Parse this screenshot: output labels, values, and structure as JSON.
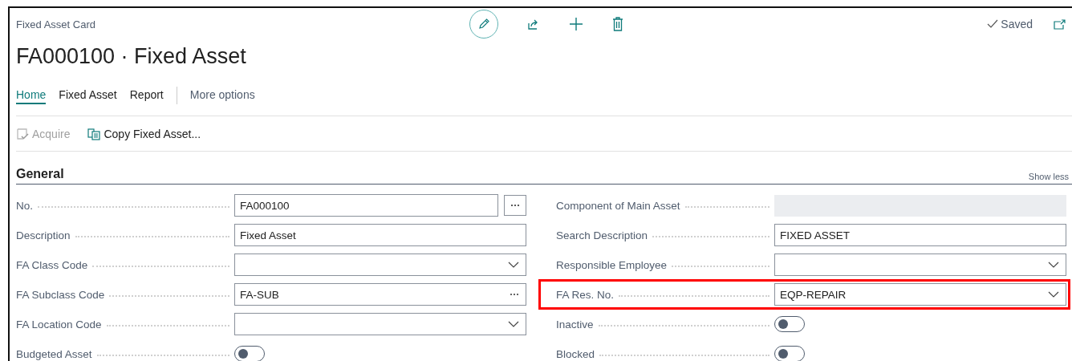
{
  "page": {
    "caption": "Fixed Asset Card",
    "title": "FA000100 · Fixed Asset",
    "status": "Saved"
  },
  "tabs": [
    {
      "label": "Home",
      "selected": true
    },
    {
      "label": "Fixed Asset",
      "selected": false
    },
    {
      "label": "Report",
      "selected": false
    }
  ],
  "more_options": "More options",
  "actions": [
    {
      "label": "Acquire",
      "disabled": true
    },
    {
      "label": "Copy Fixed Asset...",
      "disabled": false
    }
  ],
  "section": {
    "title": "General",
    "toggle": "Show less"
  },
  "left_fields": [
    {
      "label": "No.",
      "kind": "lookup",
      "value": "FA000100",
      "highlighted": false
    },
    {
      "label": "Description",
      "kind": "text",
      "value": "Fixed Asset",
      "highlighted": false
    },
    {
      "label": "FA Class Code",
      "kind": "dropdown",
      "highlighted": false
    },
    {
      "label": "FA Subclass Code",
      "kind": "assist",
      "value": "FA-SUB",
      "highlighted": false
    },
    {
      "label": "FA Location Code",
      "kind": "dropdown",
      "highlighted": false
    },
    {
      "label": "Budgeted Asset",
      "kind": "toggle",
      "on": false,
      "highlighted": false
    }
  ],
  "right_fields": [
    {
      "label": "Component of Main Asset",
      "kind": "readonly",
      "highlighted": false
    },
    {
      "label": "Search Description",
      "kind": "text",
      "value": "FIXED ASSET",
      "highlighted": false
    },
    {
      "label": "Responsible Employee",
      "kind": "dropdown",
      "highlighted": false
    },
    {
      "label": "FA Res. No.",
      "kind": "dropdown",
      "value": "EQP-REPAIR",
      "highlighted": true
    },
    {
      "label": "Inactive",
      "kind": "toggle",
      "on": false,
      "highlighted": false
    },
    {
      "label": "Blocked",
      "kind": "toggle",
      "on": false,
      "highlighted": false
    }
  ]
}
